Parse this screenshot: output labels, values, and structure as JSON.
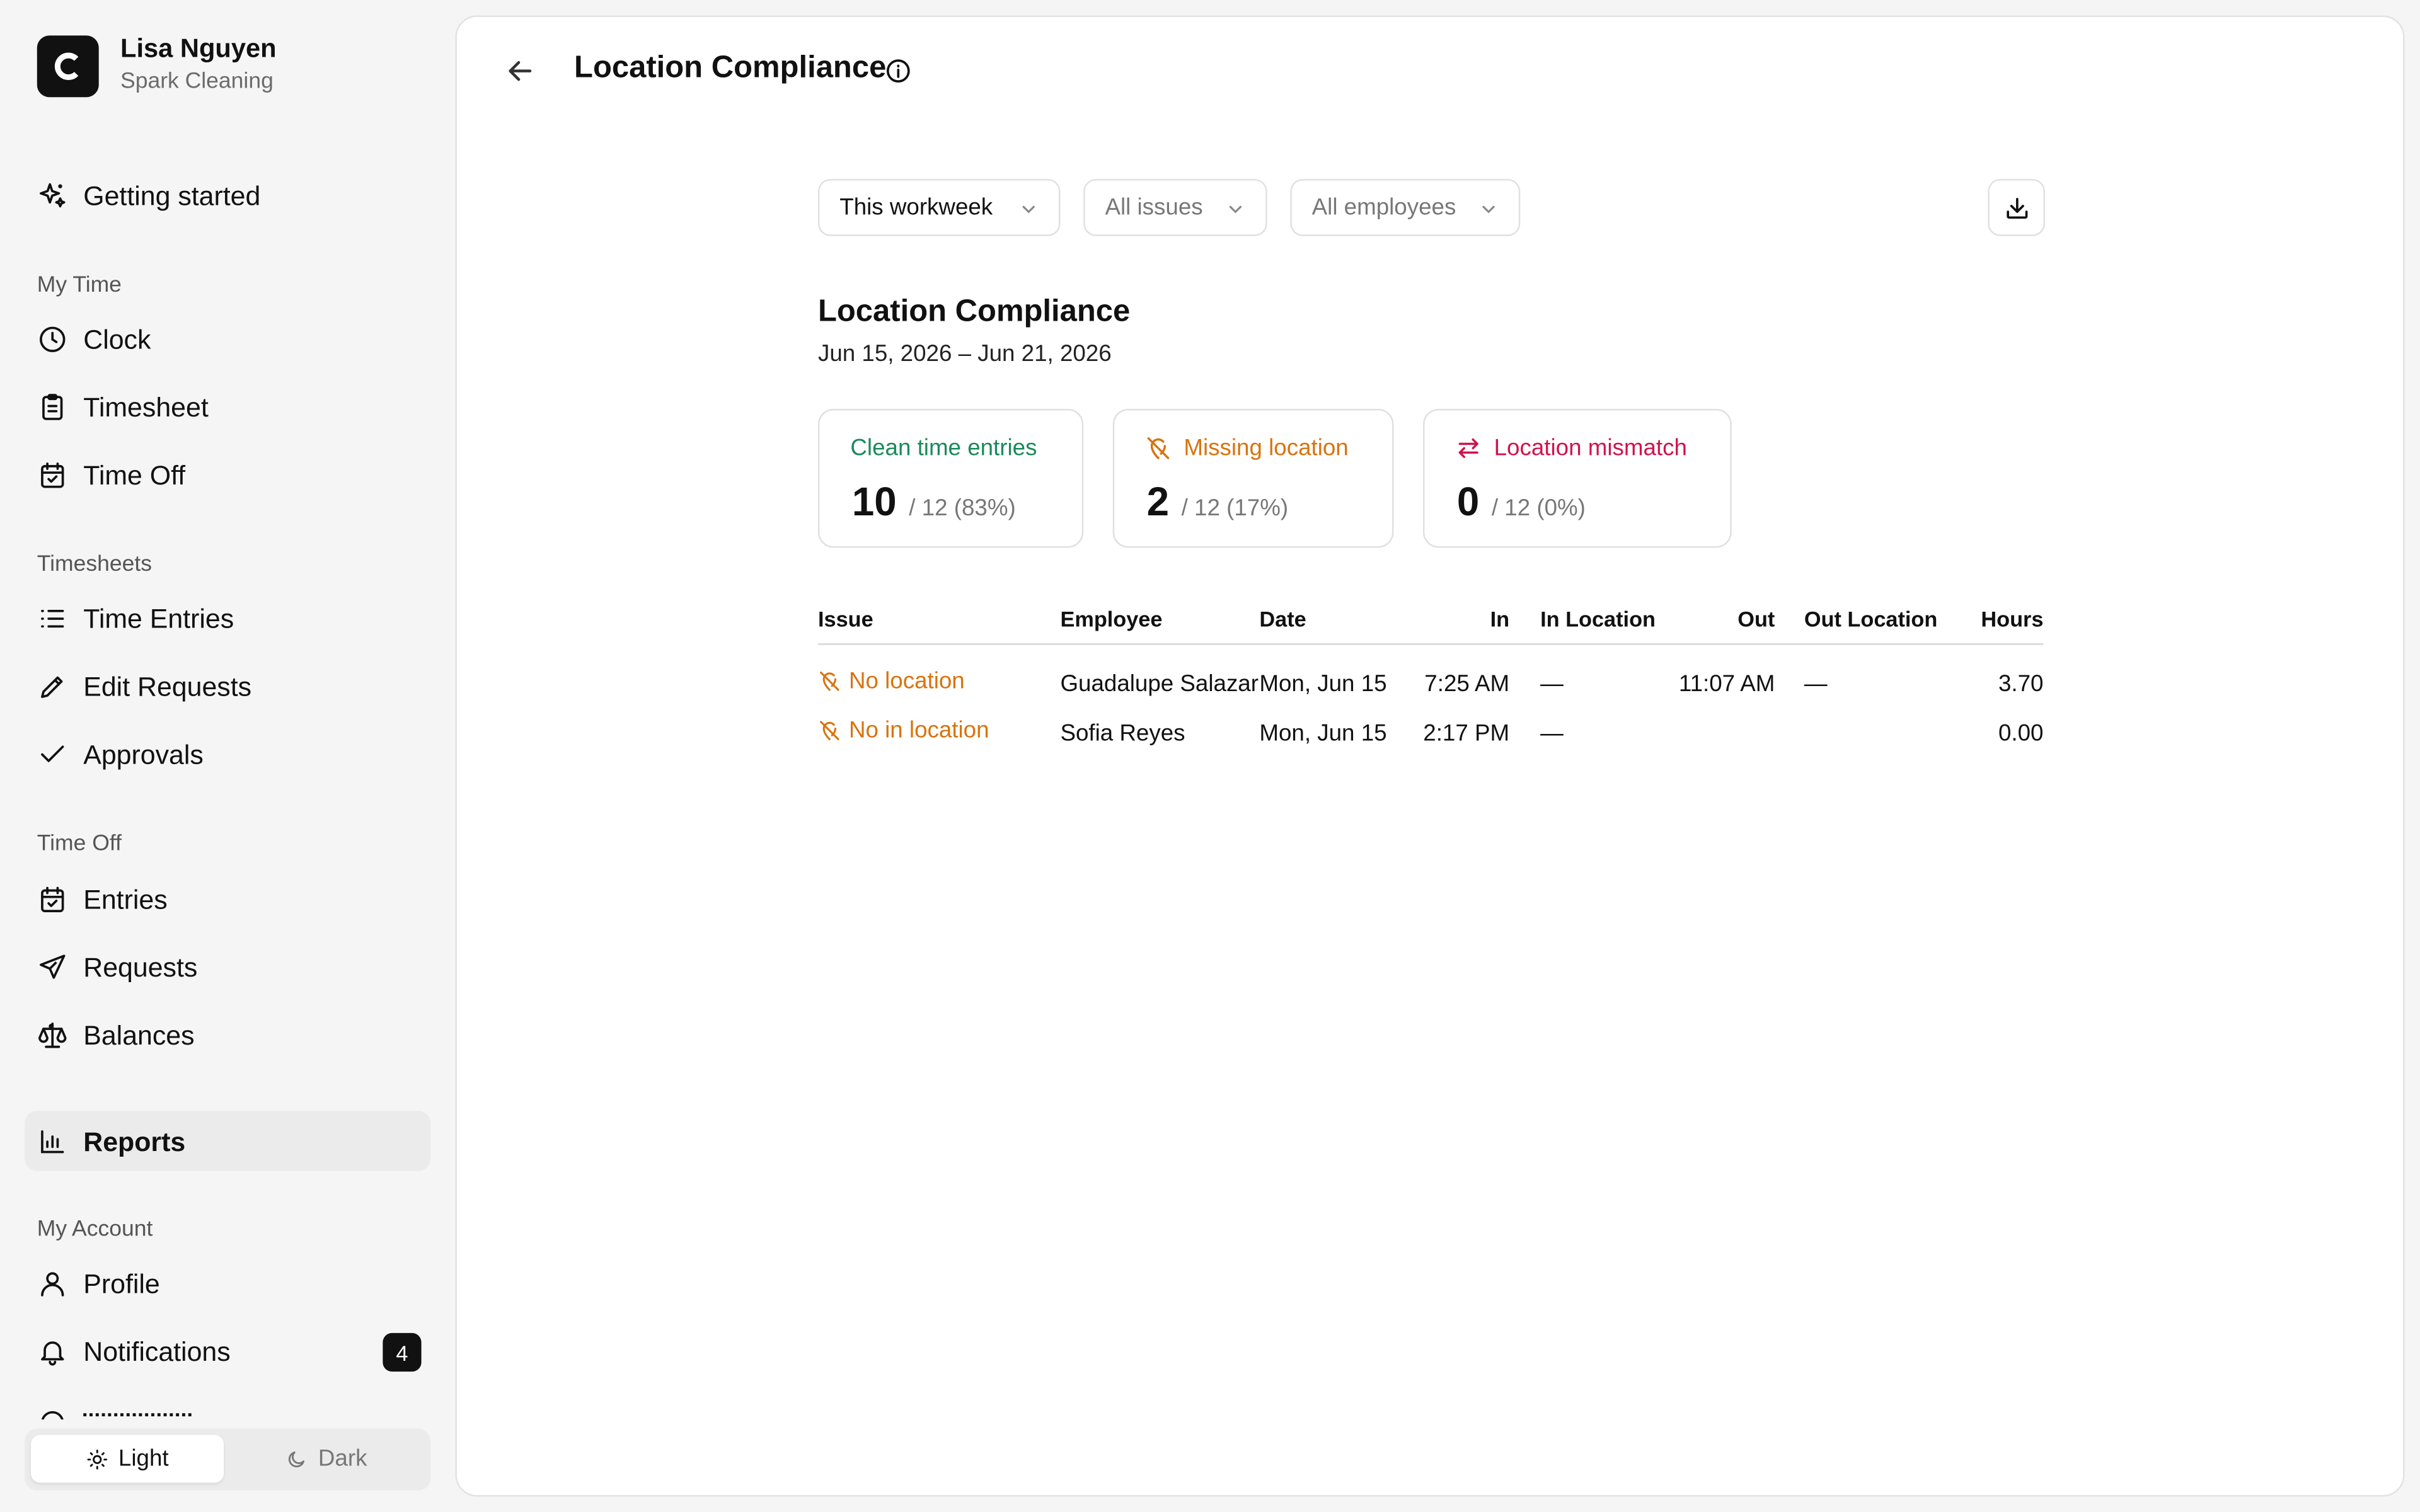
{
  "user": {
    "name": "Lisa Nguyen",
    "company": "Spark Cleaning"
  },
  "sidebar": {
    "getting_started": "Getting started",
    "sections": {
      "my_time": "My Time",
      "timesheets": "Timesheets",
      "time_off": "Time Off",
      "my_account": "My Account"
    },
    "items": {
      "clock": "Clock",
      "timesheet": "Timesheet",
      "time_off": "Time Off",
      "time_entries": "Time Entries",
      "edit_requests": "Edit Requests",
      "approvals": "Approvals",
      "entries": "Entries",
      "requests": "Requests",
      "balances": "Balances",
      "reports": "Reports",
      "profile": "Profile",
      "notifications": "Notifications"
    },
    "notifications_count": "4",
    "theme": {
      "light": "Light",
      "dark": "Dark"
    }
  },
  "header": {
    "title": "Location Compliance"
  },
  "filters": {
    "period": "This workweek",
    "issues": "All issues",
    "employees": "All employees"
  },
  "report": {
    "title": "Location Compliance",
    "range": "Jun 15, 2026 – Jun 21, 2026"
  },
  "stats": {
    "clean": {
      "label": "Clean time entries",
      "value": "10",
      "total": "/ 12 (83%)"
    },
    "missing": {
      "label": "Missing location",
      "value": "2",
      "total": "/ 12 (17%)"
    },
    "mismatch": {
      "label": "Location mismatch",
      "value": "0",
      "total": "/ 12 (0%)"
    }
  },
  "colors": {
    "green": "#1a8a5a",
    "orange": "#d9730d",
    "pink": "#d0134d"
  },
  "table": {
    "headers": {
      "issue": "Issue",
      "employee": "Employee",
      "date": "Date",
      "in": "In",
      "in_location": "In Location",
      "out": "Out",
      "out_location": "Out Location",
      "hours": "Hours"
    },
    "rows": [
      {
        "issue": "No location",
        "employee": "Guadalupe Salazar",
        "date": "Mon, Jun 15",
        "in": "7:25 AM",
        "in_location": "—",
        "out": "11:07 AM",
        "out_location": "—",
        "hours": "3.70"
      },
      {
        "issue": "No in location",
        "employee": "Sofia Reyes",
        "date": "Mon, Jun 15",
        "in": "2:17 PM",
        "in_location": "—",
        "out": "",
        "out_location": "",
        "hours": "0.00"
      }
    ]
  }
}
